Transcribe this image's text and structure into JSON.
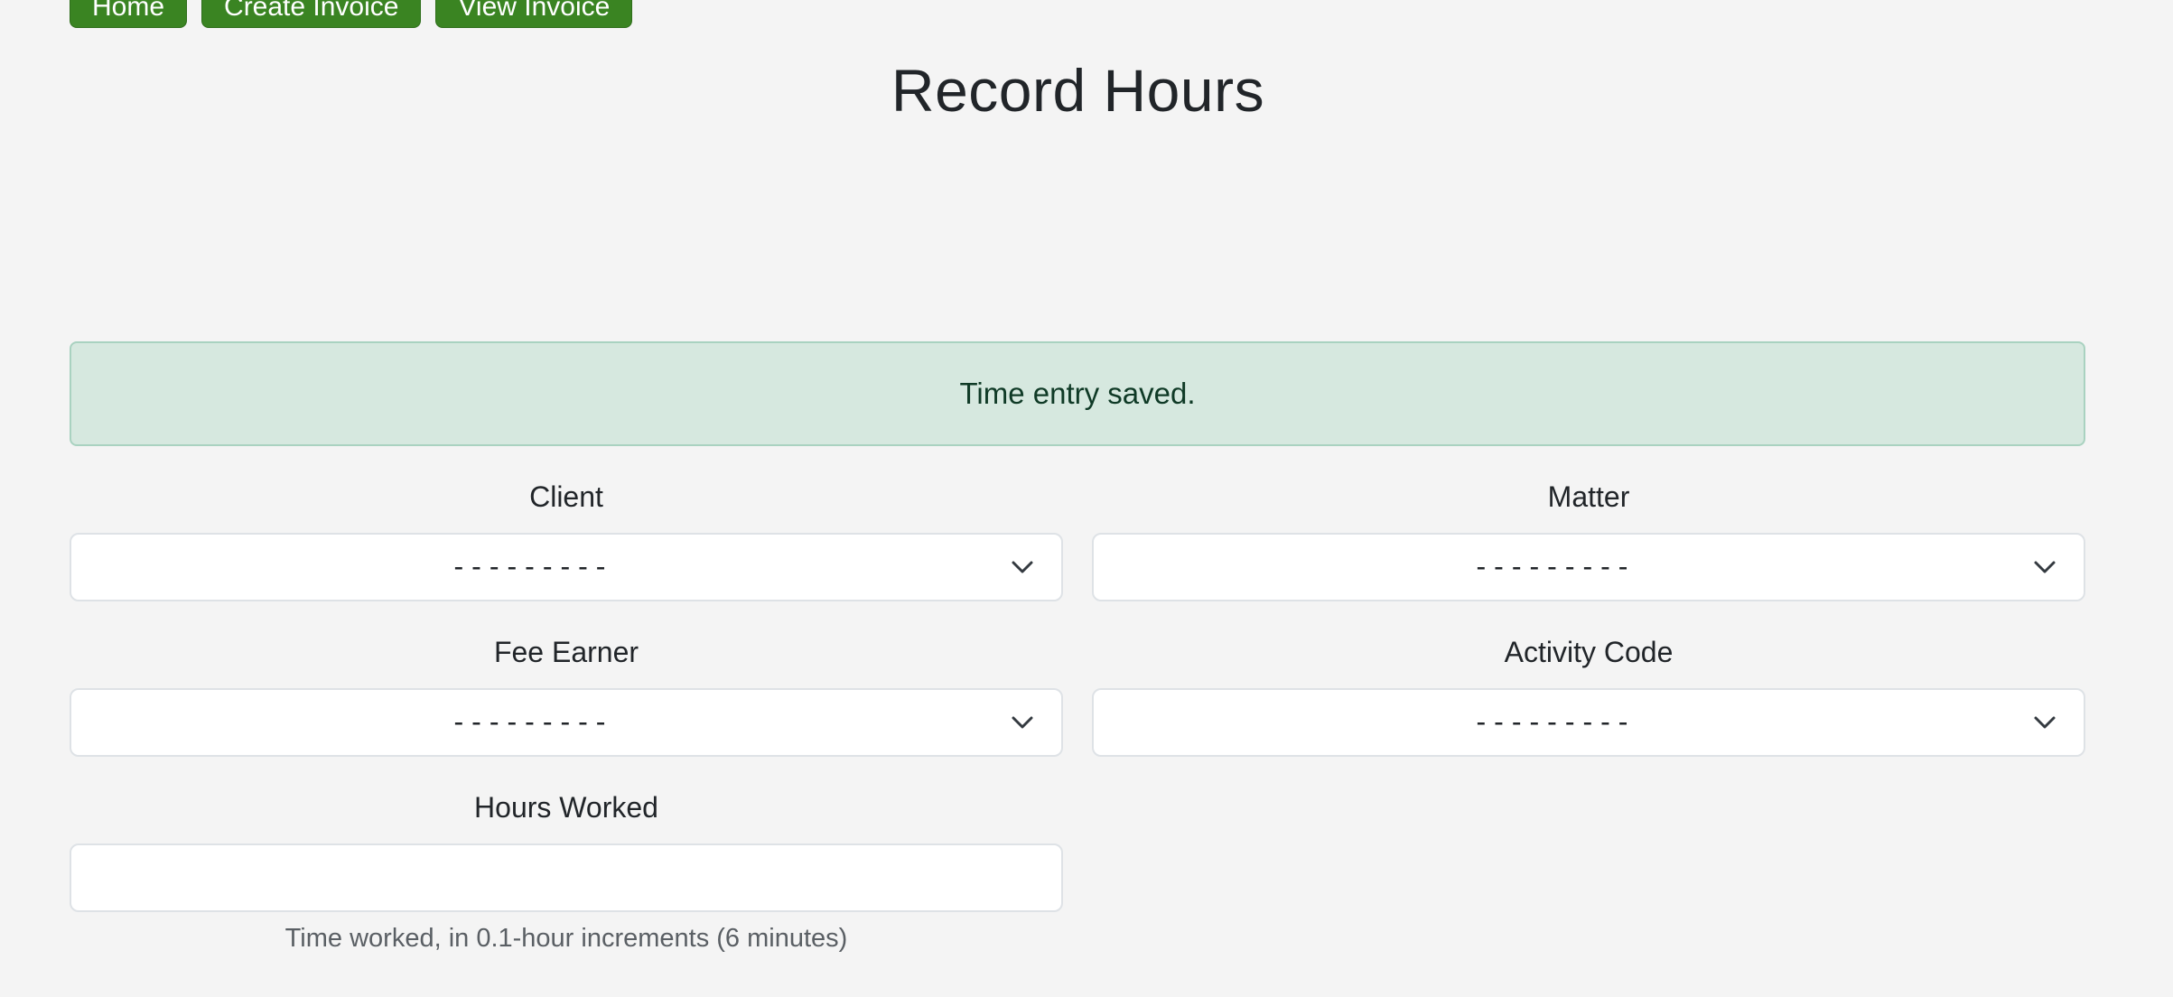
{
  "nav": {
    "home": "Home",
    "create_invoice": "Create Invoice",
    "view_invoice": "View Invoice"
  },
  "page_title": "Record Hours",
  "alert": {
    "message": "Time entry saved.",
    "color": "#d6e8df"
  },
  "form": {
    "client": {
      "label": "Client",
      "value": "---------"
    },
    "matter": {
      "label": "Matter",
      "value": "---------"
    },
    "fee_earner": {
      "label": "Fee Earner",
      "value": "---------"
    },
    "activity_code": {
      "label": "Activity Code",
      "value": "---------"
    },
    "hours_worked": {
      "label": "Hours Worked",
      "value": "",
      "help": "Time worked, in 0.1-hour increments (6 minutes)"
    }
  },
  "colors": {
    "accent": "#3a8422",
    "background": "#f4f4f4"
  },
  "icons": {
    "dropdown": "chevron-down-icon"
  }
}
